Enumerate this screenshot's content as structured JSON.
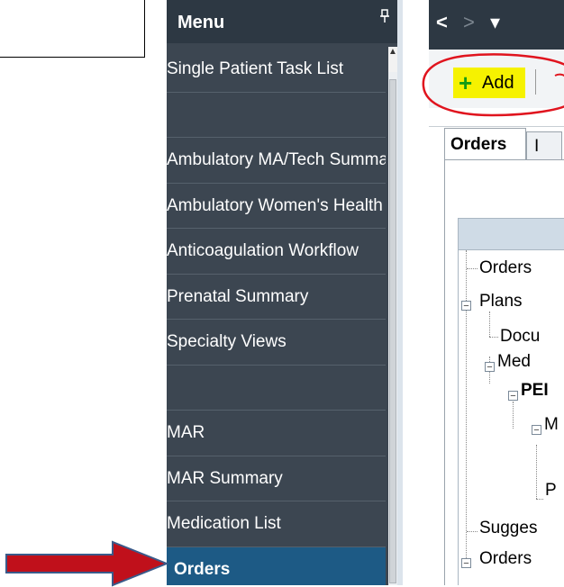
{
  "menu": {
    "title": "Menu",
    "pin_icon": "pin-icon",
    "items": [
      {
        "label": "Single Patient Task List"
      },
      {
        "label": ""
      },
      {
        "label": "Ambulatory MA/Tech Summary"
      },
      {
        "label": "Ambulatory Women's Health"
      },
      {
        "label": "Anticoagulation Workflow"
      },
      {
        "label": "Prenatal Summary"
      },
      {
        "label": "Specialty Views"
      },
      {
        "label": ""
      },
      {
        "label": "MAR"
      },
      {
        "label": "MAR Summary"
      },
      {
        "label": "Medication List"
      },
      {
        "label": "Orders"
      }
    ],
    "selected_index": 11
  },
  "nav": {
    "back_icon": "chevron-left-icon",
    "forward_icon": "chevron-right-icon",
    "back_glyph": "<",
    "forward_glyph": ">",
    "more_glyph": "▾"
  },
  "toolbar": {
    "add_label": "Add",
    "add_glyph": "+",
    "highlight_color": "#f6f200",
    "plus_color": "#149c14"
  },
  "tabs": [
    {
      "label": "Orders"
    },
    {
      "label": "I"
    }
  ],
  "tree": [
    {
      "label": "Orders"
    },
    {
      "label": "Plans"
    },
    {
      "label": "Docu"
    },
    {
      "label": "Med"
    },
    {
      "label": "PEI"
    },
    {
      "label": "M"
    },
    {
      "label": "P"
    },
    {
      "label": "Sugges"
    },
    {
      "label": "Orders"
    }
  ],
  "annotation": {
    "arrow_color": "#c0101b",
    "circle_color": "#e0141e"
  }
}
